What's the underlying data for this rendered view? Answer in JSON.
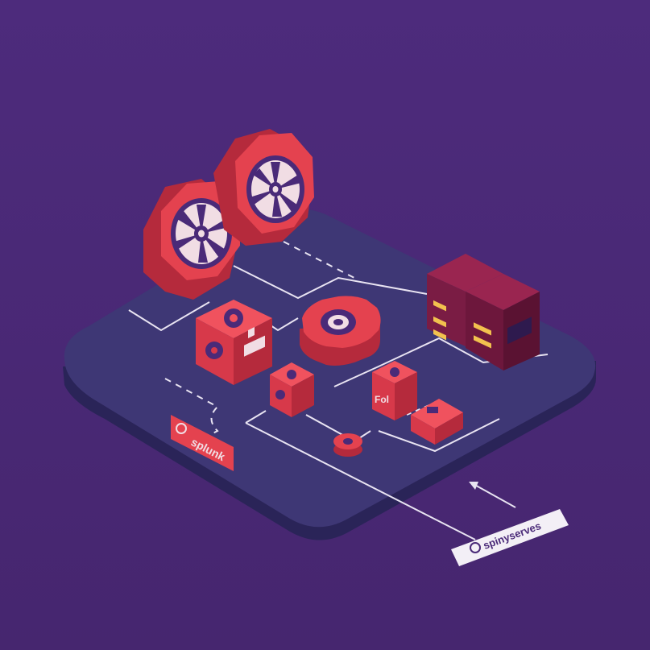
{
  "colors": {
    "background": "#4a2a78",
    "platform_top": "#3e3775",
    "platform_side": "#2a2458",
    "accent_red": "#e4424f",
    "accent_red_dark": "#b52a3c",
    "accent_red_shadow": "#8d1f33",
    "server_maroon": "#7a1c44",
    "line_white": "#e9e4f2",
    "icon_purple": "#4a2a78"
  },
  "icons": {
    "logo_left": "splunk-logo-icon",
    "logo_right": "spinner-logo-icon",
    "big_wheel": "wheel-icon",
    "gear": "gear-icon",
    "server": "server-rack-icon",
    "hub": "hub-hexagon-icon"
  },
  "labels": {
    "splunk": "splunk",
    "tag_right": "spinyserves",
    "block_text": "Fol"
  }
}
